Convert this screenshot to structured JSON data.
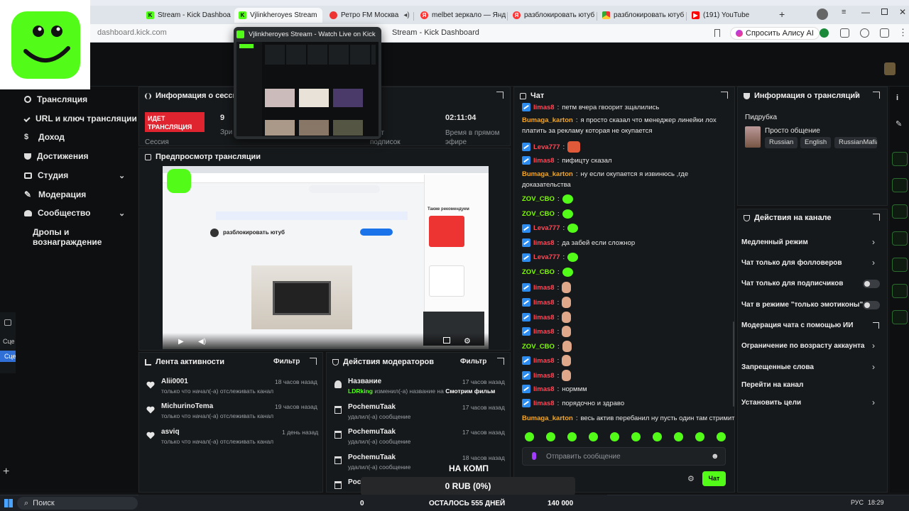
{
  "browser": {
    "tabs": [
      {
        "label": "Stream - Kick Dashboa",
        "active": false,
        "favicon": "kick-icon"
      },
      {
        "label": "Vjlinkheroyes Stream",
        "active": true,
        "favicon": "kick-icon"
      },
      {
        "label": "Ретро FM Москва",
        "active": false,
        "favicon": "radio-icon"
      },
      {
        "label": "melbet зеркало — Яндек",
        "active": false,
        "favicon": "yandex-icon"
      },
      {
        "label": "разблокировать ютуб в",
        "active": false,
        "favicon": "yandex-icon"
      },
      {
        "label": "разблокировать ютуб",
        "active": false,
        "favicon": "chrome-store-icon"
      },
      {
        "label": "(191) YouTube",
        "active": false,
        "favicon": "youtube-icon"
      }
    ],
    "url": "dashboard.kick.com",
    "page_title": "Stream - Kick Dashboard",
    "alice_label": "Спросить Алису AI",
    "tab_preview": {
      "title": "Vjlinkheroyes Stream - Watch Live on Kick"
    }
  },
  "nav": {
    "items": [
      {
        "label": "Трансляция",
        "icon": "broadcast-icon"
      },
      {
        "label": "URL и ключ трансляции",
        "icon": "key-icon"
      },
      {
        "label": "Доход",
        "icon": "money-icon"
      },
      {
        "label": "Достижения",
        "icon": "trophy-icon"
      },
      {
        "label": "Студия",
        "icon": "studio-icon",
        "expandable": true
      },
      {
        "label": "Модерация",
        "icon": "wrench-icon"
      },
      {
        "label": "Сообщество",
        "icon": "community-icon",
        "expandable": true
      },
      {
        "label": "Дропы и вознаграждение",
        "icon": ""
      }
    ],
    "left_stub_1": "Сце",
    "left_stub_2": "Сце"
  },
  "session": {
    "title": "Информация о сессии",
    "live_badge": "ИДЕТ ТРАНСЛЯЦИЯ",
    "session_label": "Сессия",
    "viewers_value": "9",
    "viewers_label": "Зри",
    "subs_label": "счет подписок",
    "uptime_value": "02:11:04",
    "uptime_label": "Время в прямом эфире"
  },
  "preview": {
    "title": "Предпросмотр трансляции",
    "store_title": "разблокировать ютуб",
    "recommend_title": "Также рекомендуем"
  },
  "chat": {
    "title": "Чат",
    "messages": [
      {
        "user": "limas8",
        "text": "петм вчера гвоорит зщалились",
        "badge": true
      },
      {
        "user": "Bumaga_karton",
        "text": "я просто сказал что менеджер линейки лох",
        "badge": false
      },
      {
        "user": "",
        "text": "платить за рекламу которая не окупается",
        "badge": false
      },
      {
        "user": "Leva777",
        "text": "",
        "badge": true,
        "emote": "red"
      },
      {
        "user": "limas8",
        "text": "пифицту сказал",
        "badge": true
      },
      {
        "user": "Bumaga_karton",
        "text": "ну если окупается я извинюсь ,где",
        "badge": false
      },
      {
        "user": "",
        "text": "доказательства",
        "badge": false
      },
      {
        "user": "ZOV_CBO",
        "text": "",
        "badge": false,
        "emote": "green"
      },
      {
        "user": "ZOV_CBO",
        "text": "",
        "badge": false,
        "emote": "green"
      },
      {
        "user": "Leva777",
        "text": "",
        "badge": true,
        "emote": "green"
      },
      {
        "user": "limas8",
        "text": "да забей если сложнор",
        "badge": true
      },
      {
        "user": "Leva777",
        "text": "",
        "badge": true,
        "emote": "green"
      },
      {
        "user": "ZOV_CBO",
        "text": "",
        "badge": false,
        "emote": "green"
      },
      {
        "user": "limas8",
        "text": "",
        "badge": true,
        "emote": "face"
      },
      {
        "user": "limas8",
        "text": "",
        "badge": true,
        "emote": "face"
      },
      {
        "user": "limas8",
        "text": "",
        "badge": true,
        "emote": "face"
      },
      {
        "user": "limas8",
        "text": "",
        "badge": true,
        "emote": "face"
      },
      {
        "user": "ZOV_CBO",
        "text": "",
        "badge": false,
        "emote": "face"
      },
      {
        "user": "limas8",
        "text": "",
        "badge": true,
        "emote": "face"
      },
      {
        "user": "limas8",
        "text": "",
        "badge": true,
        "emote": "face"
      },
      {
        "user": "limas8",
        "text": "норммм",
        "badge": true
      },
      {
        "user": "limas8",
        "text": "порядочно и здраво",
        "badge": true
      },
      {
        "user": "Bumaga_karton",
        "text": "весь актив перебанил ну пусть один там стримит",
        "badge": false
      }
    ],
    "input_placeholder": "Отправить сообщение",
    "send_label": "Чат"
  },
  "stream_info": {
    "title": "Информация о трансляции",
    "stream_title": "Пидрубка",
    "category": "Просто общение",
    "tags": [
      "Russian",
      "English",
      "RussianMafia"
    ]
  },
  "channel_actions": {
    "title": "Действия на канале",
    "items": [
      {
        "label": "Медленный режим",
        "control": "chevron"
      },
      {
        "label": "Чат только для фолловеров",
        "control": "chevron"
      },
      {
        "label": "Чат только для подписчиков",
        "control": "toggle",
        "on": false
      },
      {
        "label": "Чат в режиме \"только эмотиконы\"",
        "control": "toggle",
        "on": false
      },
      {
        "label": "Модерация чата с помощью ИИ",
        "control": "external"
      },
      {
        "label": "Ограничение по возрасту аккаунта",
        "control": "chevron"
      },
      {
        "label": "Запрещенные слова",
        "control": "chevron"
      },
      {
        "label": "Перейти на канал",
        "control": "none"
      },
      {
        "label": "Установить цели",
        "control": "chevron"
      }
    ]
  },
  "activity": {
    "title": "Лента активности",
    "filter_label": "Фильтр",
    "items": [
      {
        "name": "Alii0001",
        "desc": "только что начал(-а) отслеживать канал",
        "time": "18 часов назад"
      },
      {
        "name": "MichurinoTema",
        "desc": "только что начал(-а) отслеживать канал",
        "time": "19 часов назад"
      },
      {
        "name": "asviq",
        "desc": "только что начал(-а) отслеживать канал",
        "time": "1 день назад"
      }
    ]
  },
  "mod_actions": {
    "title": "Действия модераторов",
    "filter_label": "Фильтр",
    "items": [
      {
        "name": "Название",
        "actor": "LDRking",
        "desc": "изменил(-а) название на",
        "extra": "Смотрим фильм",
        "time": "17 часов назад",
        "icon": "user-icon"
      },
      {
        "name": "PochemuTaak",
        "actor": "",
        "desc": "удалил(-а) сообщение",
        "extra": "",
        "time": "17 часов назад",
        "icon": "trash-icon"
      },
      {
        "name": "PochemuTaak",
        "actor": "",
        "desc": "удалил(-а) сообщение",
        "extra": "",
        "time": "17 часов назад",
        "icon": "trash-icon"
      },
      {
        "name": "PochemuTaak",
        "actor": "",
        "desc": "удалил(-а) сообщение",
        "extra": "",
        "time": "18 часов назад",
        "icon": "trash-icon"
      },
      {
        "name": "Poch",
        "actor": "",
        "desc": "",
        "extra": "",
        "time": "",
        "icon": "trash-icon"
      }
    ]
  },
  "overlay": {
    "on_pc_text": "НА КОМП",
    "goal_amount": "0 RUB (0%)",
    "goal_start": "0",
    "goal_remaining": "ОСТАЛОСЬ 555 ДНЕЙ",
    "goal_target": "140 000"
  },
  "taskbar": {
    "search_placeholder": "Поиск",
    "lang": "РУС",
    "time": "18:29"
  },
  "colors": {
    "kick_green": "#53fc18",
    "live_red": "#e0242f",
    "panel_bg": "#16191b",
    "page_bg": "#111315"
  }
}
